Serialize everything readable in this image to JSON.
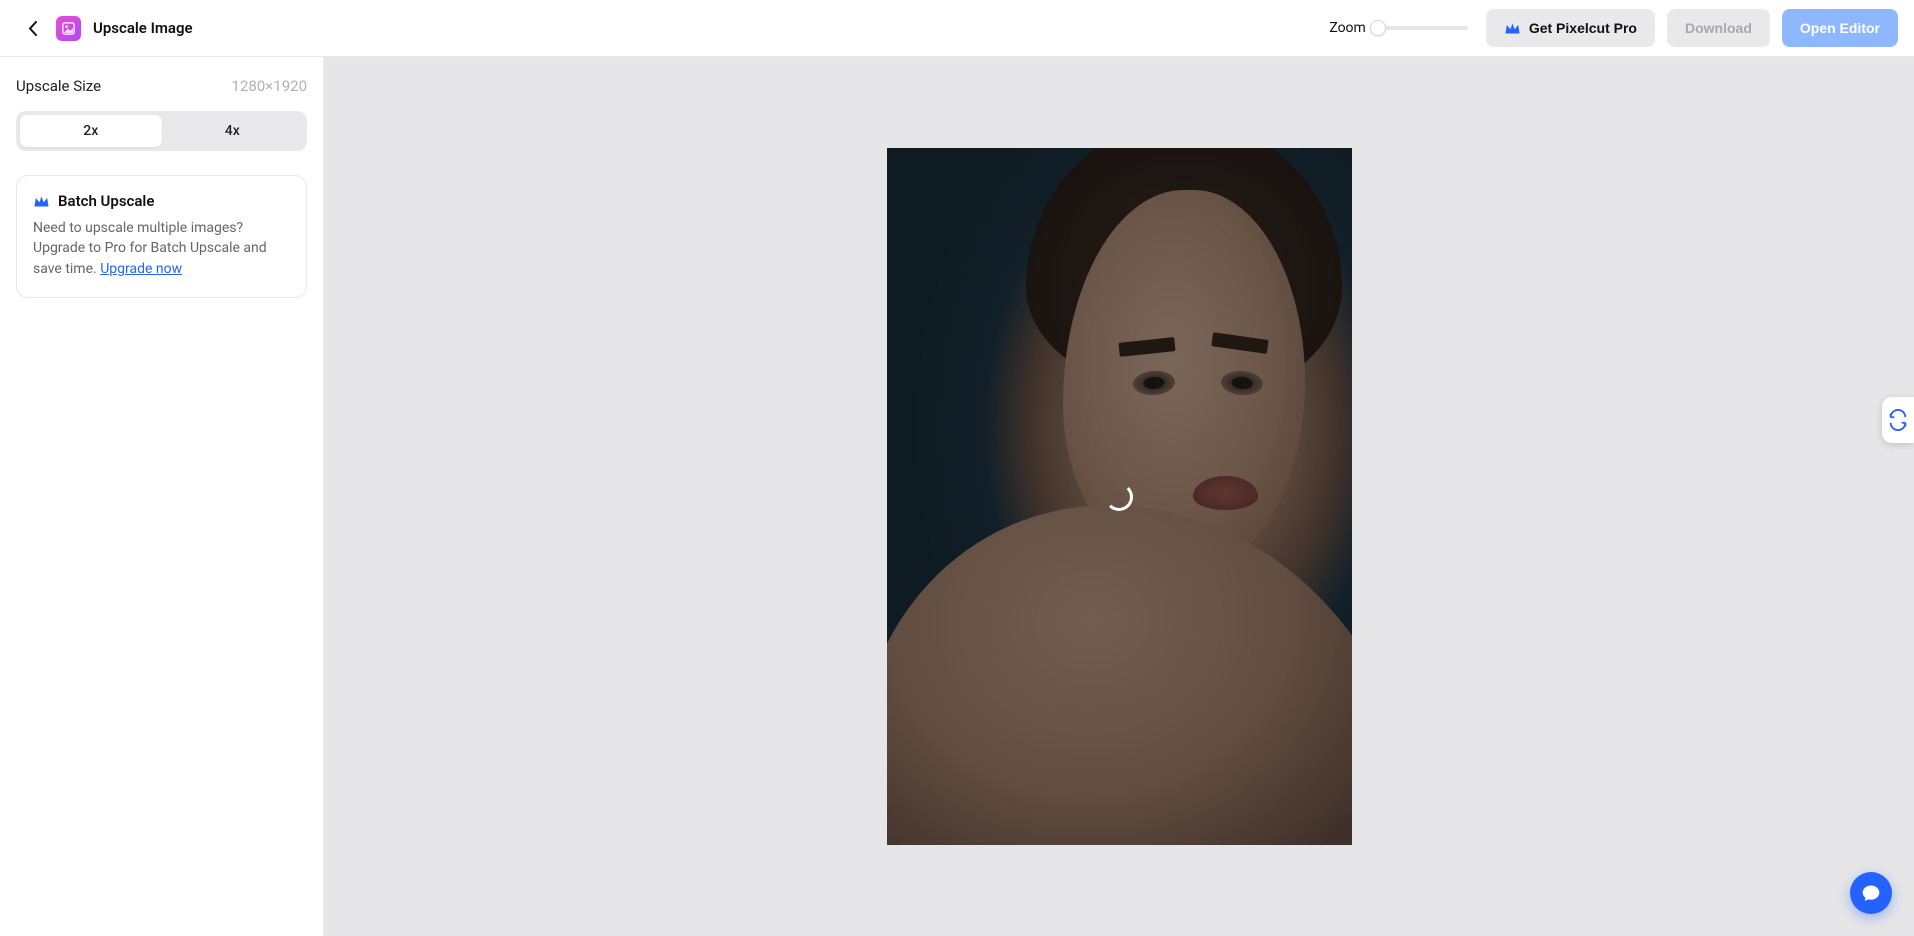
{
  "header": {
    "title": "Upscale Image",
    "zoom_label": "Zoom",
    "get_pro_label": "Get Pixelcut Pro",
    "download_label": "Download",
    "open_editor_label": "Open Editor"
  },
  "sidebar": {
    "size_label": "Upscale Size",
    "size_value": "1280×1920",
    "options": {
      "opt_2x": "2x",
      "opt_4x": "4x"
    },
    "batch": {
      "title": "Batch Upscale",
      "text_a": "Need to upscale multiple images? Upgrade to Pro for Batch Upscale and save time. ",
      "link": "Upgrade now"
    }
  },
  "colors": {
    "accent": "#2463ff",
    "canvas_bg": "#e6e6e8"
  }
}
